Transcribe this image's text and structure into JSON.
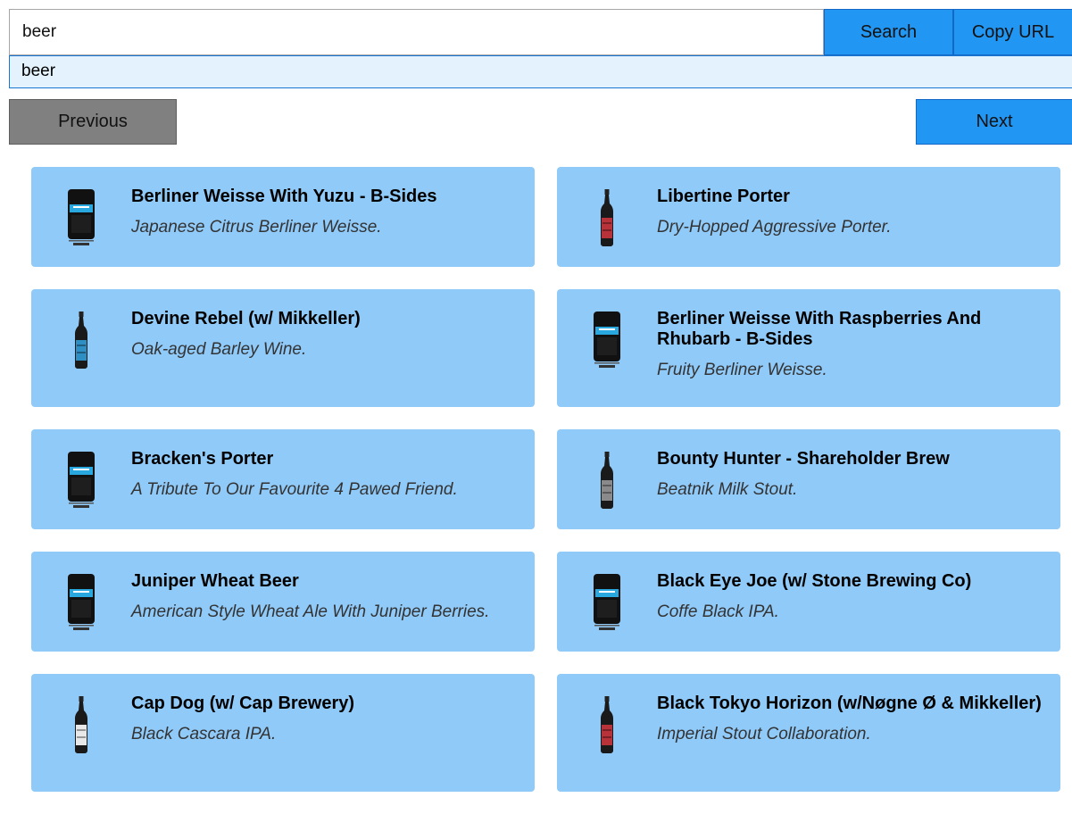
{
  "search": {
    "value": "beer",
    "search_label": "Search",
    "copy_label": "Copy URL"
  },
  "suggestions": [
    "beer"
  ],
  "pager": {
    "prev_label": "Previous",
    "next_label": "Next"
  },
  "beers": [
    {
      "name": "Berliner Weisse With Yuzu - B-Sides",
      "tagline": "Japanese Citrus Berliner Weisse.",
      "image": "keg-icon"
    },
    {
      "name": "Libertine Porter",
      "tagline": "Dry-Hopped Aggressive Porter.",
      "image": "bottle-red-label"
    },
    {
      "name": "Devine Rebel (w/ Mikkeller)",
      "tagline": "Oak-aged Barley Wine.",
      "image": "bottle-blue-label"
    },
    {
      "name": "Berliner Weisse With Raspberries And Rhubarb - B-Sides",
      "tagline": "Fruity Berliner Weisse.",
      "image": "keg-icon"
    },
    {
      "name": "Bracken's Porter",
      "tagline": "A Tribute To Our Favourite 4 Pawed Friend.",
      "image": "keg-icon"
    },
    {
      "name": "Bounty Hunter - Shareholder Brew",
      "tagline": "Beatnik Milk Stout.",
      "image": "bottle-grey-label"
    },
    {
      "name": "Juniper Wheat Beer",
      "tagline": "American Style Wheat Ale With Juniper Berries.",
      "image": "keg-icon"
    },
    {
      "name": "Black Eye Joe (w/ Stone Brewing Co)",
      "tagline": "Coffe Black IPA.",
      "image": "keg-icon"
    },
    {
      "name": "Cap Dog (w/ Cap Brewery)",
      "tagline": "Black Cascara IPA.",
      "image": "bottle-white-label"
    },
    {
      "name": "Black Tokyo Horizon (w/Nøgne Ø & Mikkeller)",
      "tagline": "Imperial Stout Collaboration.",
      "image": "bottle-red-label"
    }
  ],
  "colors": {
    "accent": "#2196f3",
    "card": "#90caf9",
    "prev": "#808080",
    "suggest_bg": "#e3f2fd"
  }
}
